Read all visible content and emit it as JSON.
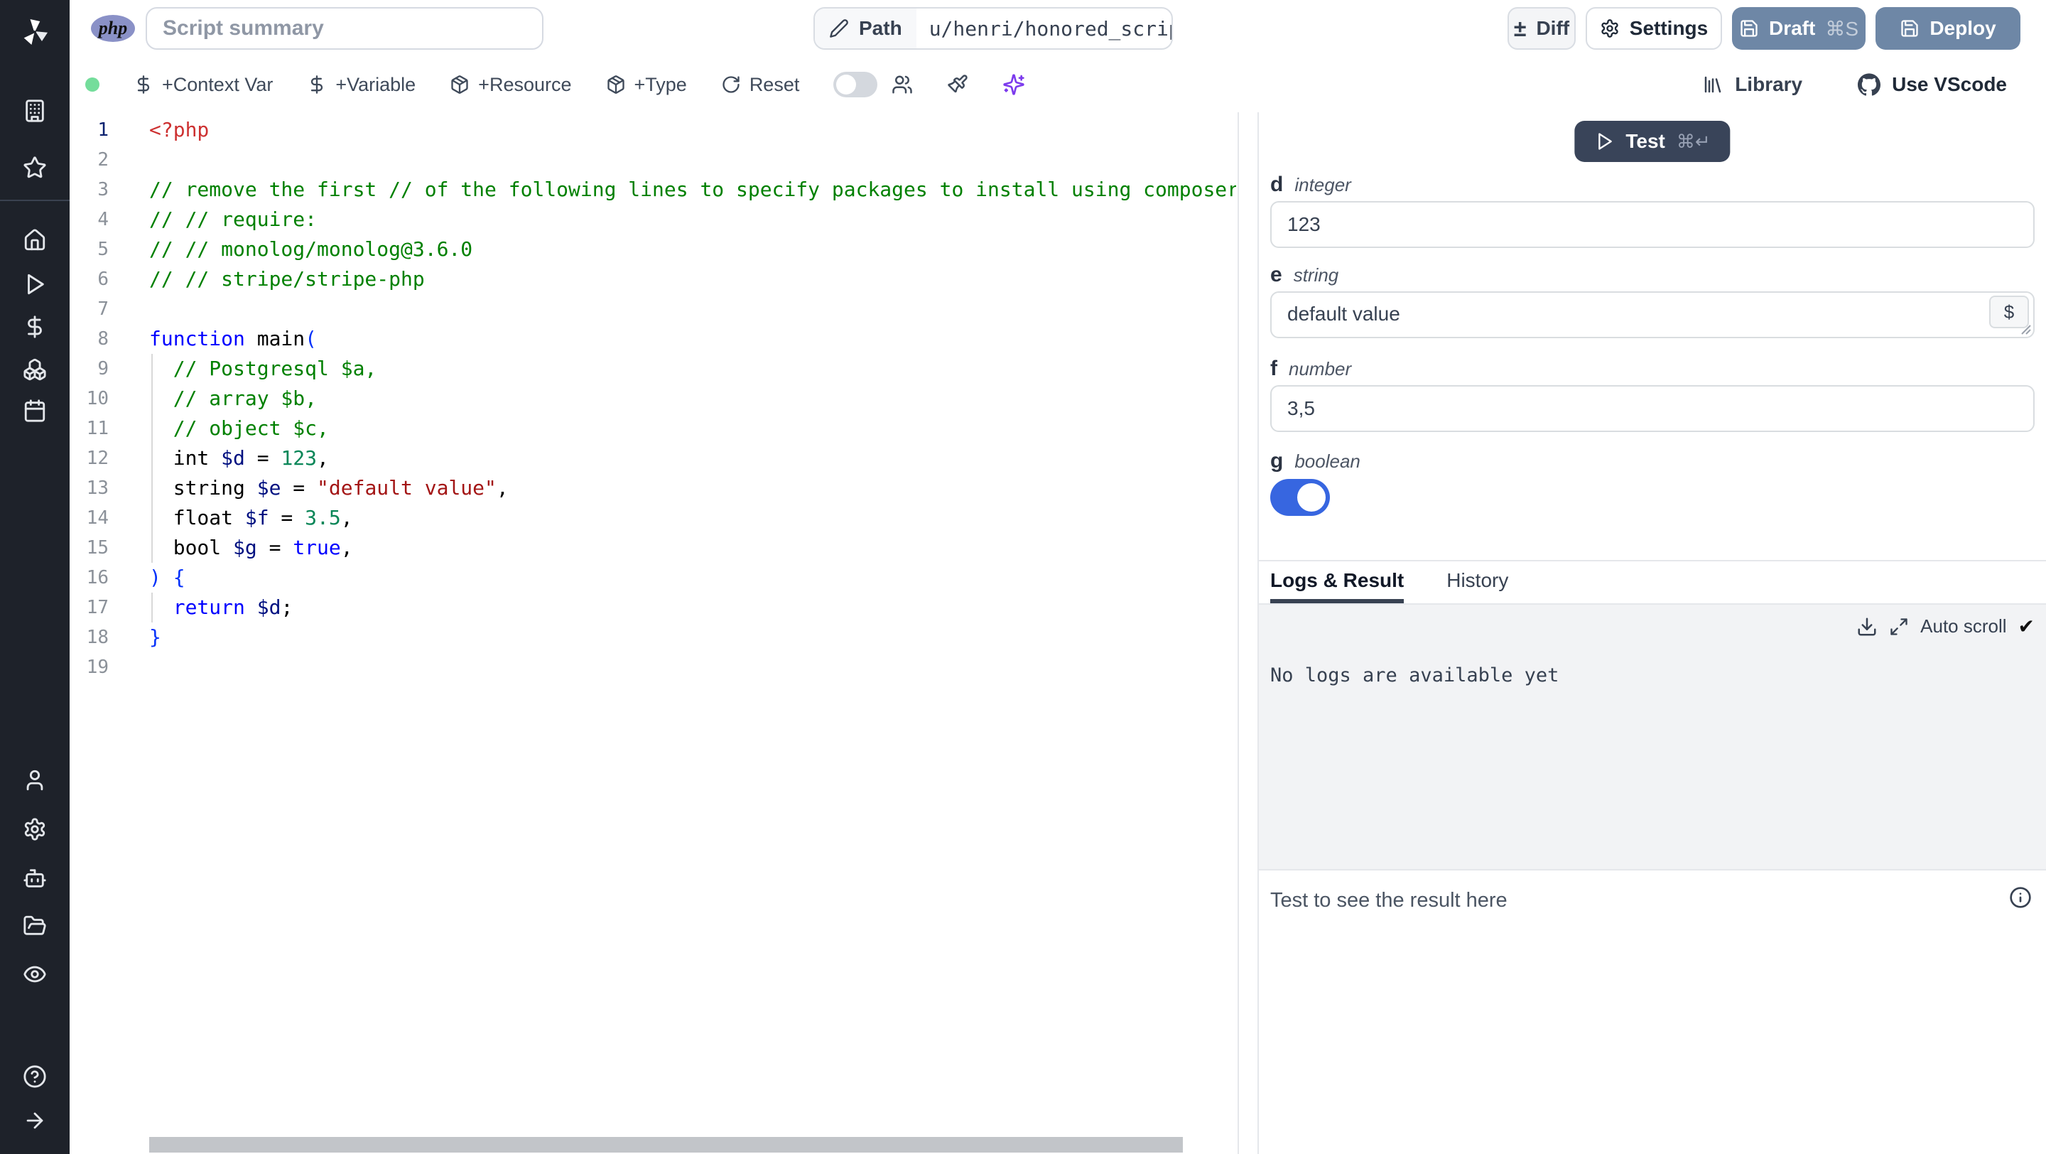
{
  "topbar": {
    "language_badge": "php",
    "summary_placeholder": "Script summary",
    "path_label": "Path",
    "path_value": "u/henri/honored_script",
    "diff_label": "Diff",
    "settings_label": "Settings",
    "draft_label": "Draft",
    "draft_shortcut": "⌘S",
    "deploy_label": "Deploy"
  },
  "toolbar": {
    "context_var_label": "+Context Var",
    "variable_label": "+Variable",
    "resource_label": "+Resource",
    "type_label": "+Type",
    "reset_label": "Reset",
    "library_label": "Library",
    "vscode_label": "Use VScode"
  },
  "sidebar": {
    "top_icons": [
      "building-icon",
      "star-icon"
    ],
    "nav_icons": [
      "home-icon",
      "runs-play-icon",
      "variables-dollar-icon",
      "resources-boxes-icon",
      "schedules-calendar-icon"
    ],
    "bottom_icons": [
      "user-icon",
      "settings-gear-icon",
      "workers-robot-icon",
      "folders-icon",
      "audit-eye-icon",
      "help-icon",
      "collapse-arrow-icon"
    ]
  },
  "editor": {
    "colors": {
      "tag": "#cd3131",
      "comment": "#008000",
      "keyword": "#0000ff",
      "plain": "#000000",
      "bracket": "#0431fa",
      "variable": "#001080",
      "number": "#098658",
      "string": "#a31515"
    },
    "lines": [
      {
        "n": 1,
        "tokens": [
          {
            "t": "<?php",
            "c": "tag"
          }
        ]
      },
      {
        "n": 2,
        "tokens": []
      },
      {
        "n": 3,
        "tokens": [
          {
            "t": "// remove the first // of the following lines to specify packages to install using composer",
            "c": "comment"
          }
        ]
      },
      {
        "n": 4,
        "tokens": [
          {
            "t": "// // require:",
            "c": "comment"
          }
        ]
      },
      {
        "n": 5,
        "tokens": [
          {
            "t": "// // monolog/monolog@3.6.0",
            "c": "comment"
          }
        ]
      },
      {
        "n": 6,
        "tokens": [
          {
            "t": "// // stripe/stripe-php",
            "c": "comment"
          }
        ]
      },
      {
        "n": 7,
        "tokens": []
      },
      {
        "n": 8,
        "tokens": [
          {
            "t": "function",
            "c": "keyword"
          },
          {
            "t": " main",
            "c": "plain"
          },
          {
            "t": "(",
            "c": "bracket"
          }
        ]
      },
      {
        "n": 9,
        "tokens": [
          {
            "t": "  // Postgresql $a,",
            "c": "comment"
          }
        ]
      },
      {
        "n": 10,
        "tokens": [
          {
            "t": "  // array $b,",
            "c": "comment"
          }
        ]
      },
      {
        "n": 11,
        "tokens": [
          {
            "t": "  // object $c,",
            "c": "comment"
          }
        ]
      },
      {
        "n": 12,
        "tokens": [
          {
            "t": "  int ",
            "c": "plain"
          },
          {
            "t": "$d",
            "c": "variable"
          },
          {
            "t": " = ",
            "c": "plain"
          },
          {
            "t": "123",
            "c": "number"
          },
          {
            "t": ",",
            "c": "plain"
          }
        ]
      },
      {
        "n": 13,
        "tokens": [
          {
            "t": "  string ",
            "c": "plain"
          },
          {
            "t": "$e",
            "c": "variable"
          },
          {
            "t": " = ",
            "c": "plain"
          },
          {
            "t": "\"default value\"",
            "c": "string"
          },
          {
            "t": ",",
            "c": "plain"
          }
        ]
      },
      {
        "n": 14,
        "tokens": [
          {
            "t": "  float ",
            "c": "plain"
          },
          {
            "t": "$f",
            "c": "variable"
          },
          {
            "t": " = ",
            "c": "plain"
          },
          {
            "t": "3.5",
            "c": "number"
          },
          {
            "t": ",",
            "c": "plain"
          }
        ]
      },
      {
        "n": 15,
        "tokens": [
          {
            "t": "  bool ",
            "c": "plain"
          },
          {
            "t": "$g",
            "c": "variable"
          },
          {
            "t": " = ",
            "c": "plain"
          },
          {
            "t": "true",
            "c": "keyword"
          },
          {
            "t": ",",
            "c": "plain"
          }
        ]
      },
      {
        "n": 16,
        "tokens": [
          {
            "t": ") {",
            "c": "bracket"
          }
        ]
      },
      {
        "n": 17,
        "tokens": [
          {
            "t": "  ",
            "c": "plain"
          },
          {
            "t": "return",
            "c": "keyword"
          },
          {
            "t": " ",
            "c": "plain"
          },
          {
            "t": "$d",
            "c": "variable"
          },
          {
            "t": ";",
            "c": "plain"
          }
        ]
      },
      {
        "n": 18,
        "tokens": [
          {
            "t": "}",
            "c": "bracket"
          }
        ]
      },
      {
        "n": 19,
        "tokens": []
      }
    ]
  },
  "runner": {
    "test_label": "Test",
    "test_shortcut": "⌘↵",
    "fields": [
      {
        "name": "d",
        "type": "integer",
        "value": "123",
        "widget": "input"
      },
      {
        "name": "e",
        "type": "string",
        "value": "default value",
        "widget": "textarea"
      },
      {
        "name": "f",
        "type": "number",
        "value": "3,5",
        "widget": "input"
      },
      {
        "name": "g",
        "type": "boolean",
        "value": true,
        "widget": "toggle"
      }
    ],
    "tabs": [
      {
        "label": "Logs & Result",
        "active": true
      },
      {
        "label": "History",
        "active": false
      }
    ],
    "auto_scroll_label": "Auto scroll",
    "auto_scroll_check": "✔",
    "logs_empty_text": "No logs are available yet",
    "result_placeholder": "Test to see the result here"
  },
  "colors": {
    "sidebar_bg": "#1e222a",
    "draft_deploy_buttons": "#6e87a6",
    "test_button": "#394459",
    "toggle_on": "#3766e0",
    "status_dot_green": "#74dd9b",
    "ai_sparkles": "#7c3aed",
    "php_badge": "#8a91c7",
    "logs_bg": "#f2f3f5"
  }
}
